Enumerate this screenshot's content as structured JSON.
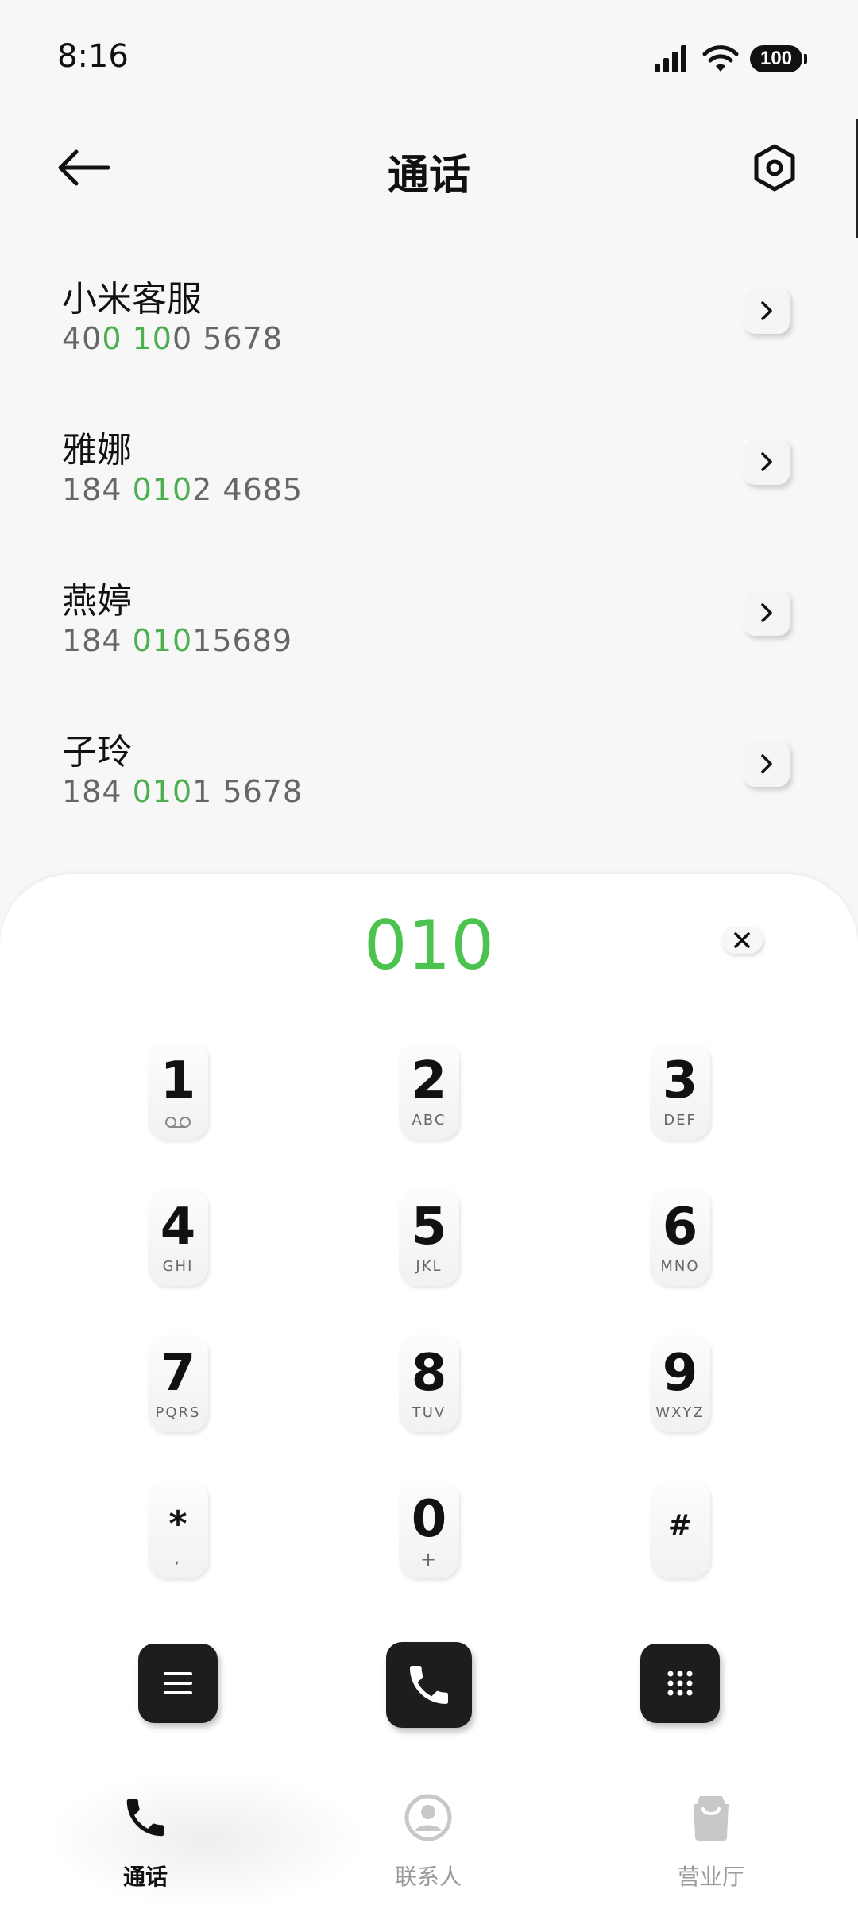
{
  "status_bar": {
    "time": "8:16",
    "battery": "100",
    "icons": [
      "signal-icon",
      "wifi-icon",
      "battery-icon"
    ]
  },
  "header": {
    "title": "通话",
    "back_icon": "back-arrow-icon",
    "settings_icon": "hexagon-settings-icon"
  },
  "contacts": [
    {
      "name": "小米客服",
      "number_parts": [
        {
          "t": "40",
          "hl": false
        },
        {
          "t": "0 10",
          "hl": true
        },
        {
          "t": "0 5678",
          "hl": false
        }
      ]
    },
    {
      "name": "雅娜",
      "number_parts": [
        {
          "t": "184 ",
          "hl": false
        },
        {
          "t": "010",
          "hl": true
        },
        {
          "t": "2 4685",
          "hl": false
        }
      ]
    },
    {
      "name": "燕婷",
      "number_parts": [
        {
          "t": "184 ",
          "hl": false
        },
        {
          "t": "010",
          "hl": true
        },
        {
          "t": "15689",
          "hl": false
        }
      ]
    },
    {
      "name": "子玲",
      "number_parts": [
        {
          "t": "184 ",
          "hl": false
        },
        {
          "t": "010",
          "hl": true
        },
        {
          "t": "1 5678",
          "hl": false
        }
      ]
    }
  ],
  "dialer": {
    "input": "010",
    "keys": [
      {
        "digit": "1",
        "letters": "voicemail-icon"
      },
      {
        "digit": "2",
        "letters": "ABC"
      },
      {
        "digit": "3",
        "letters": "DEF"
      },
      {
        "digit": "4",
        "letters": "GHI"
      },
      {
        "digit": "5",
        "letters": "JKL"
      },
      {
        "digit": "6",
        "letters": "MNO"
      },
      {
        "digit": "7",
        "letters": "PQRS"
      },
      {
        "digit": "8",
        "letters": "TUV"
      },
      {
        "digit": "9",
        "letters": "WXYZ"
      },
      {
        "digit": "*",
        "letters": ","
      },
      {
        "digit": "0",
        "letters": "+"
      },
      {
        "digit": "#",
        "letters": ""
      }
    ],
    "accent_color": "#4cc24f"
  },
  "bottom_nav": [
    {
      "label": "通话",
      "icon": "phone-icon",
      "active": true
    },
    {
      "label": "联系人",
      "icon": "contact-person-icon",
      "active": false
    },
    {
      "label": "营业厅",
      "icon": "shopping-bag-icon",
      "active": false
    }
  ],
  "colors": {
    "highlight": "#4caf50",
    "button_dark": "#1d1d1d",
    "background": "#f7f7f7"
  }
}
